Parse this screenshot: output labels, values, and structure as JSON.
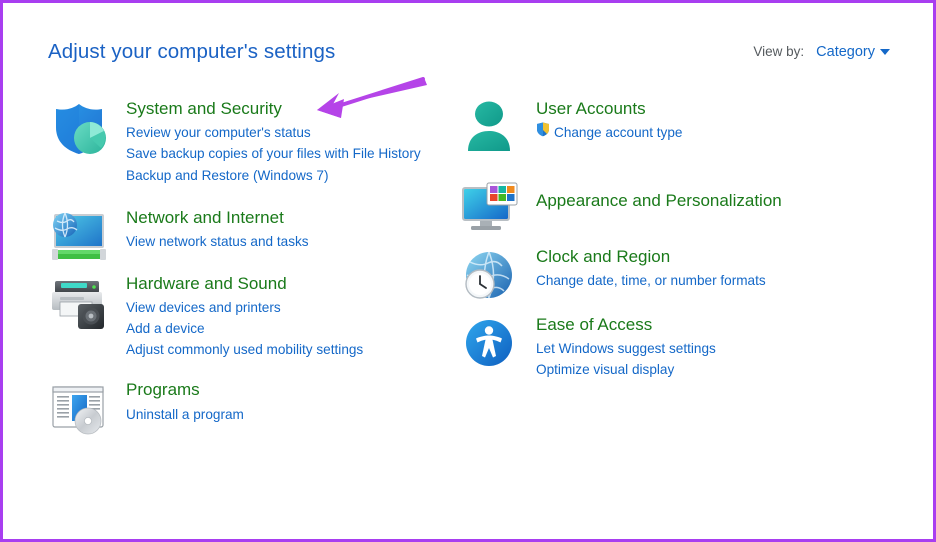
{
  "window": {
    "title": "Adjust your computer's settings",
    "border_color": "#a83ef0"
  },
  "view_by": {
    "label": "View by:",
    "value": "Category",
    "caret_icon": "chevron-down-icon"
  },
  "colors": {
    "heading_green": "#1a7a1a",
    "link_blue": "#1468c8",
    "title_blue": "#1b62c4",
    "annotation_purple": "#b544e8"
  },
  "annotation": {
    "type": "arrow",
    "points_to": "System and Security",
    "color": "#b544e8"
  },
  "columns": {
    "left": [
      {
        "title": "System and Security",
        "icon": "shield-icon",
        "links": [
          "Review your computer's status",
          "Save backup copies of your files with File History",
          "Backup and Restore (Windows 7)"
        ]
      },
      {
        "title": "Network and Internet",
        "icon": "network-globe-monitor-icon",
        "links": [
          "View network status and tasks"
        ]
      },
      {
        "title": "Hardware and Sound",
        "icon": "printer-speaker-icon",
        "links": [
          "View devices and printers",
          "Add a device",
          "Adjust commonly used mobility settings"
        ]
      },
      {
        "title": "Programs",
        "icon": "program-window-disc-icon",
        "links": [
          "Uninstall a program"
        ]
      }
    ],
    "right": [
      {
        "title": "User Accounts",
        "icon": "user-person-icon",
        "links": [
          "Change account type"
        ],
        "link_shields": [
          true
        ]
      },
      {
        "title": "Appearance and Personalization",
        "icon": "monitor-palette-icon",
        "links": []
      },
      {
        "title": "Clock and Region",
        "icon": "globe-clock-icon",
        "links": [
          "Change date, time, or number formats"
        ]
      },
      {
        "title": "Ease of Access",
        "icon": "accessibility-icon",
        "links": [
          "Let Windows suggest settings",
          "Optimize visual display"
        ]
      }
    ]
  }
}
